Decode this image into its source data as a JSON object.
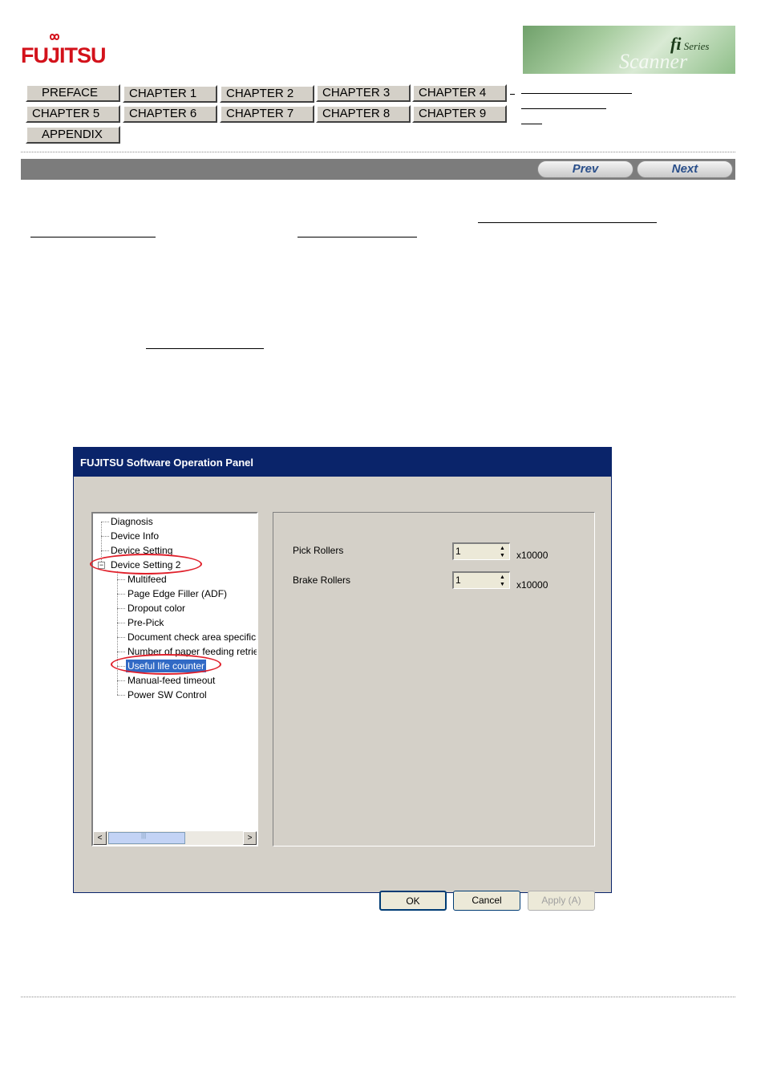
{
  "header": {
    "logo_text": "FUJITSU",
    "banner": {
      "brand": "fi",
      "series": "Series",
      "product": "Scanner"
    }
  },
  "nav": {
    "buttons": [
      "PREFACE",
      "CHAPTER 1",
      "CHAPTER 2",
      "CHAPTER 3",
      "CHAPTER 4",
      "CHAPTER 5",
      "CHAPTER 6",
      "CHAPTER 7",
      "CHAPTER 8",
      "CHAPTER 9",
      "APPENDIX"
    ],
    "page_buttons": {
      "prev": "Prev",
      "next": "Next"
    }
  },
  "dialog": {
    "title": "FUJITSU Software Operation Panel",
    "tree": [
      "Diagnosis",
      "Device Info",
      "Device Setting",
      "Device Setting 2",
      "Multifeed",
      "Page Edge Filler (ADF)",
      "Dropout color",
      "Pre-Pick",
      "Document check area specific",
      "Number of paper feeding retrie",
      "Useful life counter",
      "Manual-feed timeout",
      "Power SW Control"
    ],
    "expander_symbol": "−",
    "settings": {
      "pick": {
        "label": "Pick Rollers",
        "value": "1",
        "unit": "x10000"
      },
      "brake": {
        "label": "Brake Rollers",
        "value": "1",
        "unit": "x10000"
      }
    },
    "buttons": {
      "ok": "OK",
      "cancel": "Cancel",
      "apply": "Apply (A)"
    },
    "scroll": {
      "left": "<",
      "right": ">",
      "grip": "|||"
    }
  },
  "colors": {
    "accent_red": "#e0202b",
    "selection": "#316ac5",
    "titlebar": "#0a246a"
  }
}
